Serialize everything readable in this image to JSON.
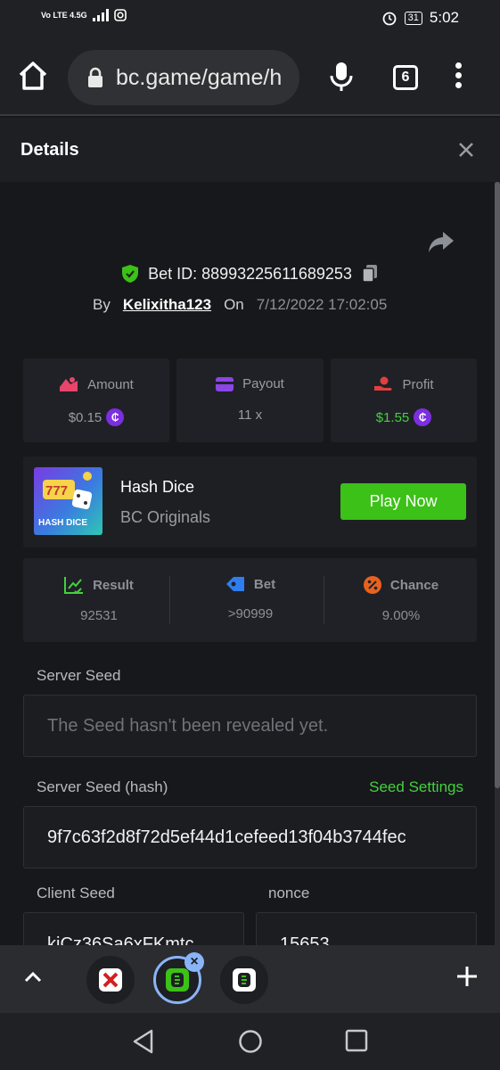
{
  "status_bar": {
    "network": "Vo LTE 4.5G",
    "battery": "31",
    "time": "5:02"
  },
  "browser": {
    "url": "bc.game/game/h",
    "tab_count": "6"
  },
  "modal": {
    "title": "Details"
  },
  "bet": {
    "id_label": "Bet ID: 88993225611689253",
    "by_label": "By",
    "user": "Kelixitha123",
    "on_label": "On",
    "date": "7/12/2022 17:02:05"
  },
  "stats": {
    "amount_label": "Amount",
    "amount_value": "$0.15",
    "payout_label": "Payout",
    "payout_value": "11 x",
    "profit_label": "Profit",
    "profit_value": "$1.55",
    "coin_symbol": "₵"
  },
  "game": {
    "thumb_text": "HASH DICE",
    "name": "Hash Dice",
    "provider": "BC Originals",
    "play_label": "Play Now"
  },
  "outcome": {
    "result_label": "Result",
    "result_value": "92531",
    "bet_label": "Bet",
    "bet_value": ">90999",
    "chance_label": "Chance",
    "chance_value": "9.00%"
  },
  "fields": {
    "server_seed_label": "Server Seed",
    "server_seed_placeholder": "The Seed hasn't been revealed yet.",
    "server_seed_hash_label": "Server Seed (hash)",
    "seed_settings_label": "Seed Settings",
    "server_seed_hash_value": "9f7c63f2d8f72d5ef44d1cefeed13f04b3744fec",
    "client_seed_label": "Client Seed",
    "client_seed_value": "kiCz36Sa6xFKmtc",
    "nonce_label": "nonce",
    "nonce_value": "15653"
  },
  "colors": {
    "accent_green": "#3bc117",
    "profit_green": "#43d13e",
    "coin_purple": "#7b2fe0",
    "background": "#17181b"
  }
}
